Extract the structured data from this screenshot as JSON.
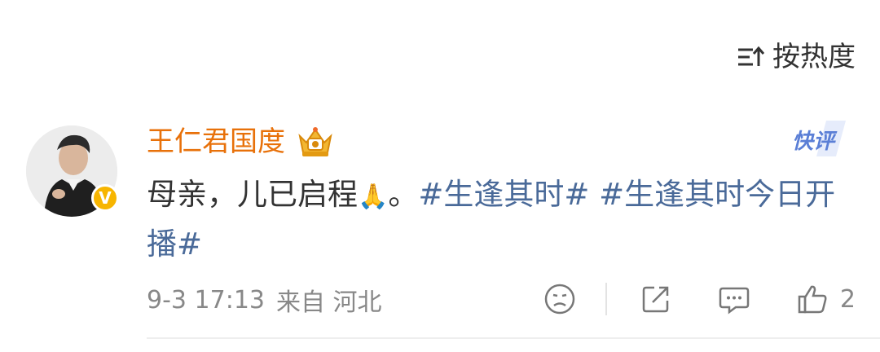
{
  "sort": {
    "label": "按热度",
    "icon": "sort-hot-icon"
  },
  "comment": {
    "username": "王仁君国度",
    "fan_badge_icon": "fan-crown-icon",
    "verified_badge": "V",
    "quick_review_label": "快评",
    "text_plain": "母亲，儿已启程",
    "emoji": "🙏",
    "text_after_emoji": "。",
    "hashtag_1": "#生逢其时#",
    "hashtag_2": "#生逢其时今日开播#",
    "time": "9-3 17:13",
    "source": "来自 河北",
    "like_count": "2"
  },
  "colors": {
    "username": "#e8710a",
    "hashtag": "#4a6a99",
    "meta": "#888888",
    "verified": "#f7b500"
  }
}
